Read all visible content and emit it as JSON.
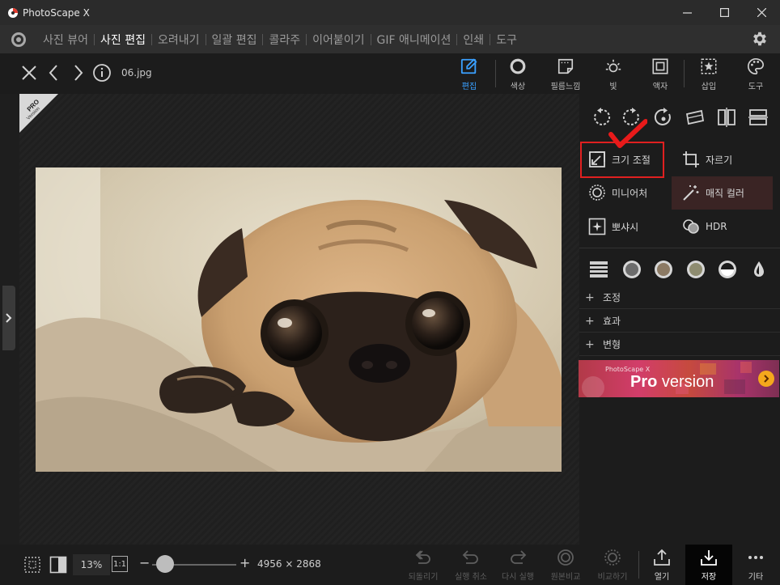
{
  "app": {
    "title": "PhotoScape X"
  },
  "menu": {
    "items": [
      {
        "label": "사진 뷰어",
        "active": false
      },
      {
        "label": "사진 편집",
        "active": true
      },
      {
        "label": "오려내기",
        "active": false
      },
      {
        "label": "일괄 편집",
        "active": false
      },
      {
        "label": "콜라주",
        "active": false
      },
      {
        "label": "이어붙이기",
        "active": false
      },
      {
        "label": "GIF 애니메이션",
        "active": false
      },
      {
        "label": "인쇄",
        "active": false
      },
      {
        "label": "도구",
        "active": false
      }
    ]
  },
  "file": {
    "name": "06.jpg"
  },
  "tools": {
    "edit": "편집",
    "color": "색상",
    "film": "필름느낌",
    "light": "빛",
    "frame": "액자",
    "insert": "삽입",
    "tools": "도구"
  },
  "pro_corner": {
    "line1": "PRO",
    "line2": "Version"
  },
  "features": {
    "resize": "크기 조절",
    "crop": "자르기",
    "miniature": "미니어처",
    "magic_color": "매직 컬러",
    "sharpen": "뽀샤시",
    "hdr": "HDR"
  },
  "accordion": {
    "adjust": "조정",
    "effects": "효과",
    "transform": "변형",
    "plus": "+"
  },
  "banner": {
    "small": "PhotoScape X",
    "pro": "Pro",
    "version": " version"
  },
  "status": {
    "zoom": "13%",
    "one_to_one": "1:1",
    "minus": "−",
    "plus": "+",
    "dimensions": "4956 × 2868",
    "undo_all": "되돌리기",
    "undo": "실행 취소",
    "redo": "다시 실행",
    "compare": "원본비교",
    "compare2": "비교하기",
    "open": "열기",
    "save": "저장",
    "more": "기타"
  },
  "colors": {
    "accent": "#3aa0ff",
    "highlight": "#e02020",
    "checkmark": "#e81a1a"
  }
}
